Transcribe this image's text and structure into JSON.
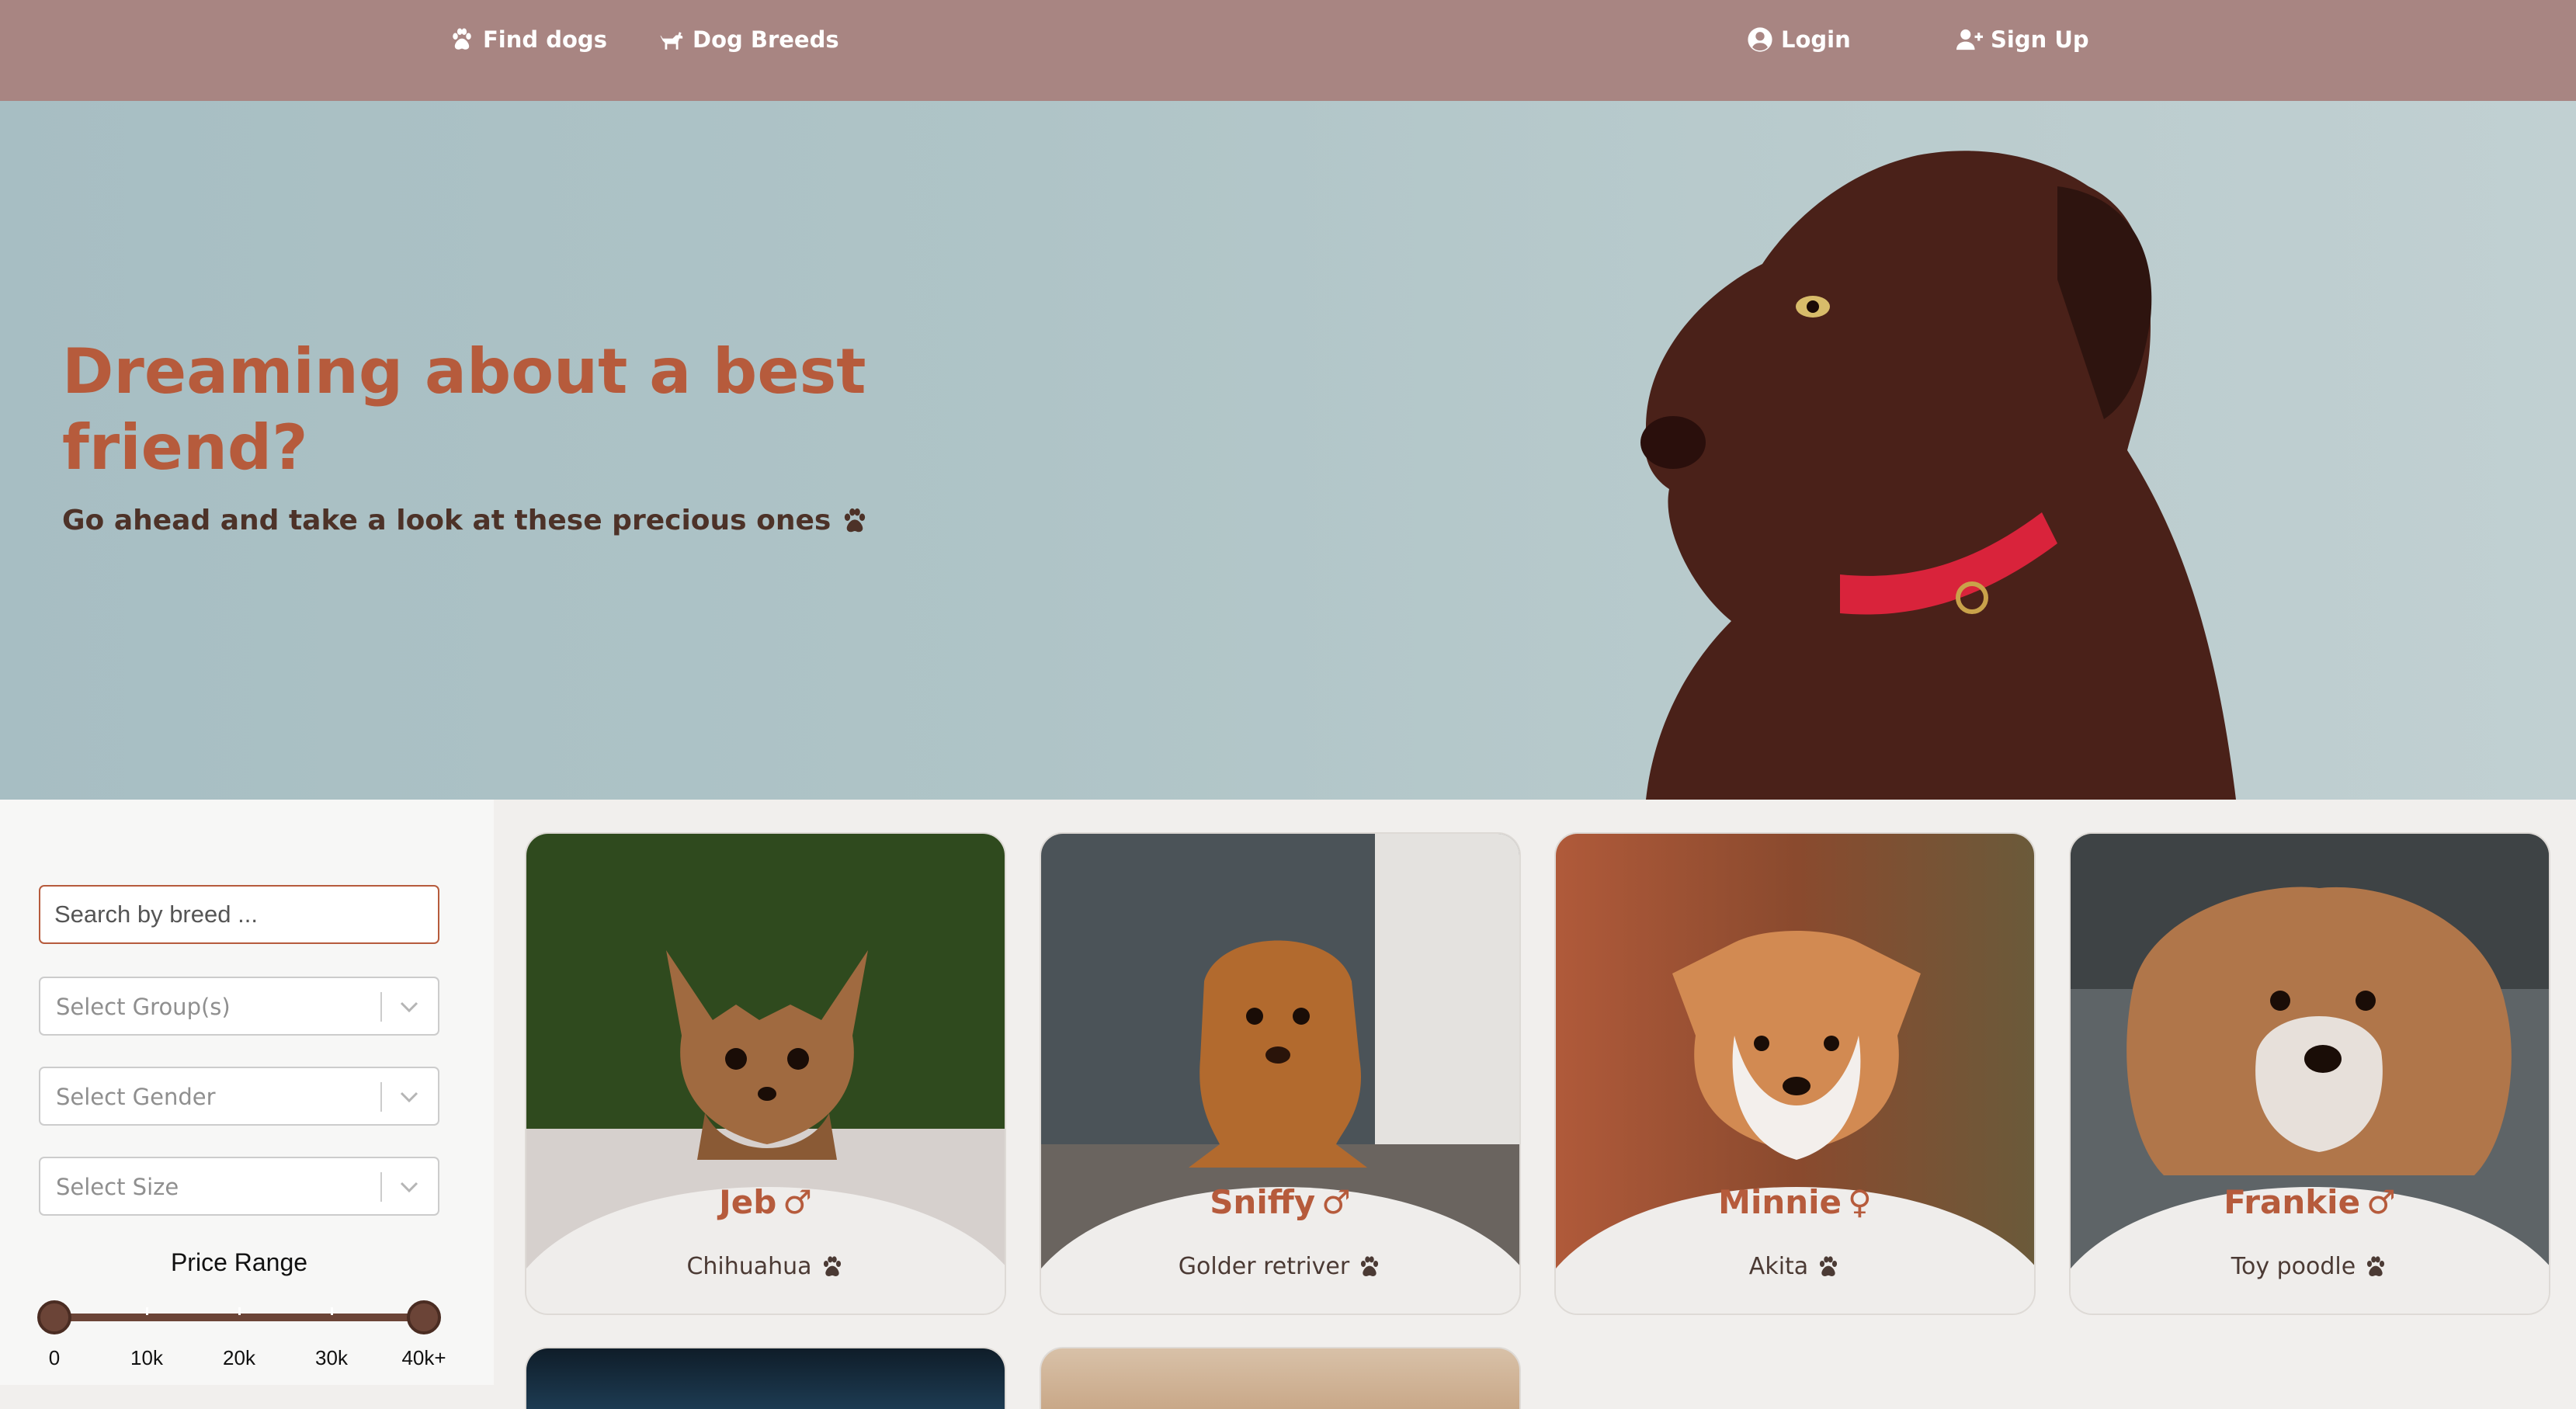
{
  "nav": {
    "find_dogs": "Find dogs",
    "dog_breeds": "Dog Breeds",
    "login": "Login",
    "sign_up": "Sign Up"
  },
  "hero": {
    "title": "Dreaming about a best friend?",
    "subtitle": "Go ahead and take a look at these precious ones"
  },
  "filters": {
    "search_placeholder": "Search by breed ...",
    "group_placeholder": "Select Group(s)",
    "gender_placeholder": "Select Gender",
    "size_placeholder": "Select Size",
    "price_label": "Price Range",
    "price_ticks": [
      "0",
      "10k",
      "20k",
      "30k",
      "40k+"
    ]
  },
  "dogs": [
    {
      "name": "Jeb",
      "gender": "♂",
      "breed": "Chihuahua"
    },
    {
      "name": "Sniffy",
      "gender": "♂",
      "breed": "Golder retriver"
    },
    {
      "name": "Minnie",
      "gender": "♀",
      "breed": "Akita"
    },
    {
      "name": "Frankie",
      "gender": "♂",
      "breed": "Toy poodle"
    }
  ],
  "colors": {
    "navbar": "#a88582",
    "accent": "#b65b3c",
    "dark_brown": "#4d3228",
    "slider": "#6b4437"
  },
  "icons": {
    "find_dogs": "paw-icon",
    "dog_breeds": "dog-icon",
    "login": "user-circle-icon",
    "sign_up": "user-plus-icon",
    "breed": "paw-icon",
    "select": "chevron-down-icon"
  }
}
